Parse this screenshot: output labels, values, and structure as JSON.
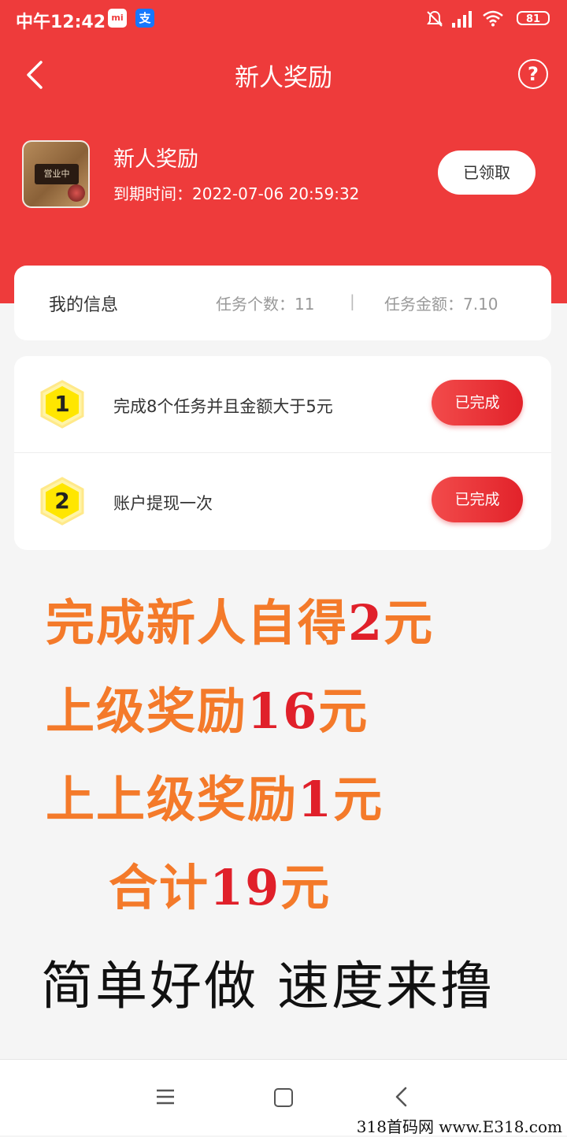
{
  "status_bar": {
    "time": "中午12:42",
    "mi_badge": "mi",
    "alipay_badge": "支",
    "battery": "81",
    "icons": [
      "mute-bell-icon",
      "signal-icon",
      "wifi-icon",
      "battery-icon"
    ]
  },
  "nav": {
    "title": "新人奖励",
    "back_icon": "chevron-left-icon",
    "help_icon": "question-circle-icon",
    "help_glyph": "?"
  },
  "reward": {
    "title": "新人奖励",
    "expiry": "到期时间：2022-07-06 20:59:32",
    "status_button": "已领取",
    "thumb_sign": "営业中"
  },
  "my_info": {
    "title": "我的信息",
    "task_count": "任务个数：11",
    "separator": "|",
    "task_amount": "任务金额：7.10"
  },
  "tasks": [
    {
      "index": "1",
      "text": "完成8个任务并且金额大于5元",
      "status": "已完成"
    },
    {
      "index": "2",
      "text": "账户提现一次",
      "status": "已完成"
    }
  ],
  "promo": {
    "line1_text": "完成新人自得",
    "line1_num": "2",
    "line1_unit": "元",
    "line2_text": "上级奖励",
    "line2_num": "16",
    "line2_unit": "元",
    "line3_text": "上上级奖励",
    "line3_num": "1",
    "line3_unit": "元",
    "line4_text": "合计",
    "line4_num": "19",
    "line4_unit": "元",
    "slogan": "简单好做 速度来撸"
  },
  "watermark": "318首码网  www.E318.com",
  "colors": {
    "header_red": "#ee3b3b",
    "button_red": "#e2222a",
    "promo_orange": "#f47a2a",
    "promo_red": "#e0202a",
    "hex_yellow": "#ffe600"
  }
}
